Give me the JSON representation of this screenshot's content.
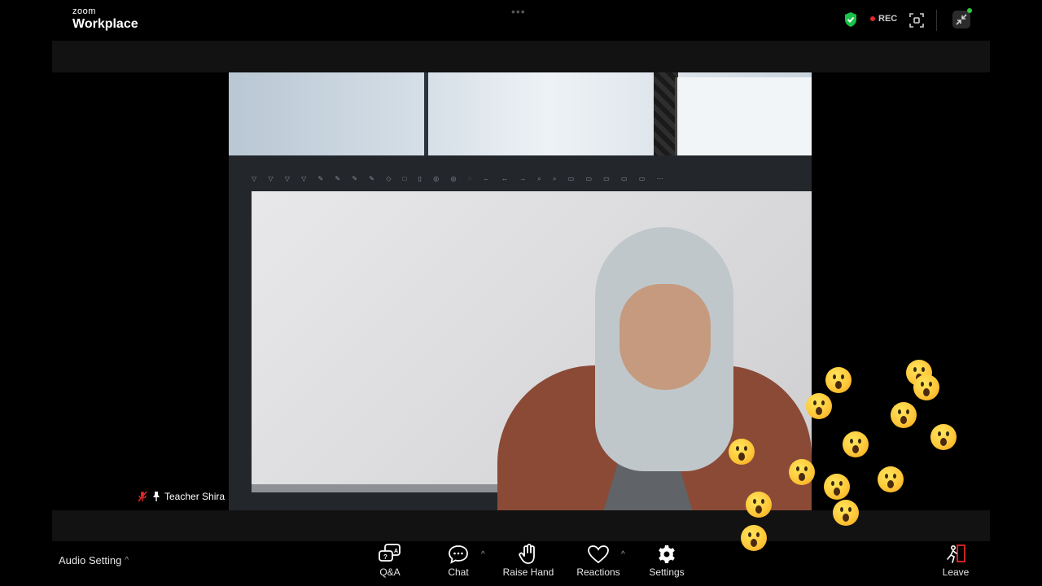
{
  "app": {
    "brand": "zoom",
    "product": "Workplace"
  },
  "top_bar": {
    "recording_label": "REC",
    "colors": {
      "secure": "#19c24a",
      "recording_dot": "#e02828",
      "notification_dot": "#2ecc40"
    }
  },
  "participant": {
    "name": "Teacher Shira",
    "muted": true,
    "pinned": true
  },
  "reactions": {
    "emoji": "face-with-open-mouth",
    "visible_count": 16
  },
  "toolbar": {
    "audio_setting_label": "Audio Setting",
    "qa_label": "Q&A",
    "chat_label": "Chat",
    "raise_hand_label": "Raise Hand",
    "reactions_label": "Reactions",
    "settings_label": "Settings",
    "leave_label": "Leave"
  }
}
